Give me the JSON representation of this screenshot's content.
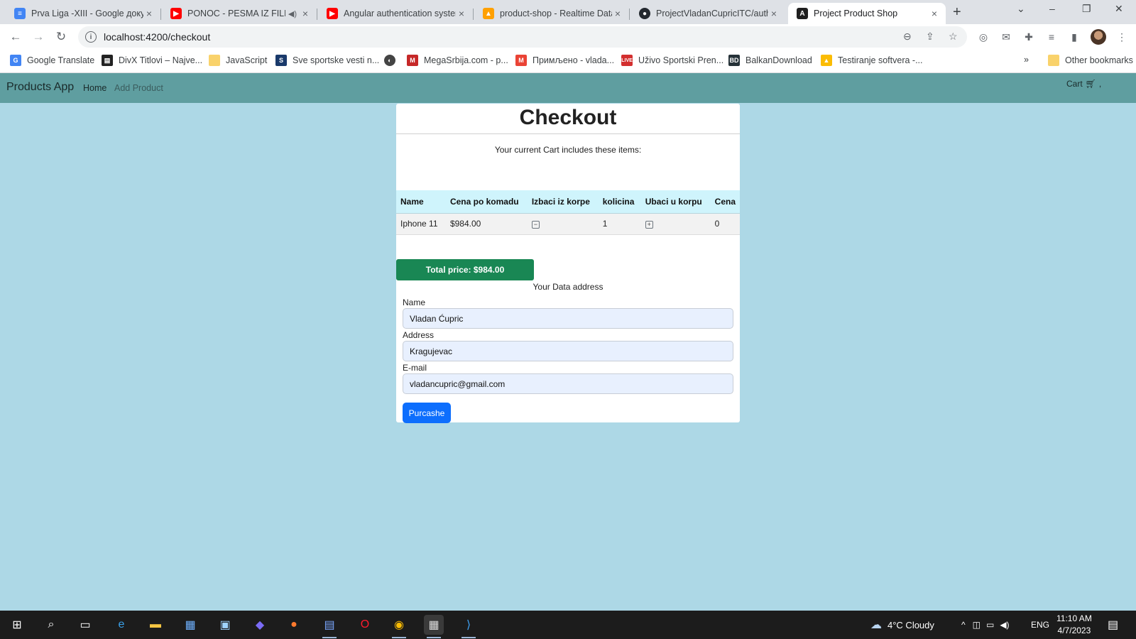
{
  "browser": {
    "tabs": [
      {
        "title": "Prva Liga -XIII - Google доку...",
        "icon": "google-docs-icon",
        "active": false
      },
      {
        "title": "PONOC - PESMA IZ FILM...",
        "icon": "youtube-icon",
        "active": false,
        "muted": true
      },
      {
        "title": "Angular authentication syster...",
        "icon": "youtube-icon",
        "active": false
      },
      {
        "title": "product-shop - Realtime Data...",
        "icon": "firebase-icon",
        "active": false
      },
      {
        "title": "ProjectVladanCupricITC/auth...",
        "icon": "github-icon",
        "active": false
      },
      {
        "title": "Project Product Shop",
        "icon": "angular-icon",
        "active": true
      }
    ],
    "url": "localhost:4200/checkout",
    "bookmarks": [
      {
        "label": "Google Translate",
        "icon": "google-translate-icon"
      },
      {
        "label": "DivX Titlovi – Najve...",
        "icon": "divx-icon"
      },
      {
        "label": "JavaScript",
        "icon": "folder-icon"
      },
      {
        "label": "Sve sportske vesti n...",
        "icon": "sport-icon"
      },
      {
        "label": "",
        "icon": "globe-icon"
      },
      {
        "label": "MegaSrbija.com - p...",
        "icon": "megasrbija-icon"
      },
      {
        "label": "Примљено - vlada...",
        "icon": "gmail-icon"
      },
      {
        "label": "Uživo Sportski Pren...",
        "icon": "live-icon"
      },
      {
        "label": "BalkanDownload",
        "icon": "balkandownload-icon"
      },
      {
        "label": "Testiranje softvera -...",
        "icon": "google-drive-icon"
      }
    ],
    "other_bookmarks": "Other bookmarks"
  },
  "app": {
    "brand": "Products App",
    "nav": {
      "home": "Home",
      "add_product": "Add Product"
    },
    "cart_label": "Cart",
    "cart_suffix": ","
  },
  "checkout": {
    "title": "Checkout",
    "intro": "Your current Cart includes these items:",
    "columns": [
      "Name",
      "Cena po komadu",
      "Izbaci iz korpe",
      "kolicina",
      "Ubaci u korpu",
      "Cena"
    ],
    "items": [
      {
        "name": "Iphone 11",
        "unit_price": "$984.00",
        "remove_symbol": "−",
        "quantity": "1",
        "add_symbol": "+",
        "price": "0"
      }
    ],
    "total": "Total price: $984.00",
    "address_title": "Your Data address",
    "form": {
      "name_label": "Name",
      "name_value": "Vladan Ćupric",
      "address_label": "Address",
      "address_value": "Kragujevac",
      "email_label": "E-mail",
      "email_value": "vladancupric@gmail.com",
      "submit": "Purcashe"
    }
  },
  "taskbar": {
    "weather": "4°C  Cloudy",
    "lang": "ENG",
    "time": "11:10 AM",
    "date": "4/7/2023"
  },
  "colors": {
    "page_bg": "#add8e6",
    "navbar_bg": "#5f9ea0",
    "table_header_bg": "#cff4fc",
    "total_bg": "#198754",
    "purchase_bg": "#0d6efd"
  }
}
